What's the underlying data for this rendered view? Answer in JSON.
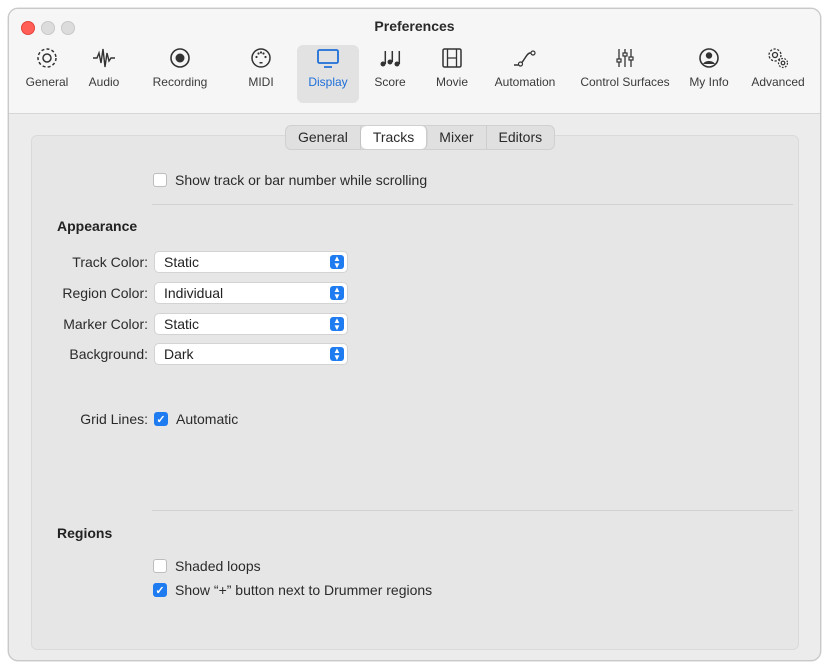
{
  "window": {
    "title": "Preferences"
  },
  "toolbar": {
    "items": [
      {
        "label": "General",
        "icon": "gear-icon"
      },
      {
        "label": "Audio",
        "icon": "waveform-icon"
      },
      {
        "label": "Recording",
        "icon": "record-icon"
      },
      {
        "label": "MIDI",
        "icon": "midi-port-icon"
      },
      {
        "label": "Display",
        "icon": "display-icon",
        "active": true
      },
      {
        "label": "Score",
        "icon": "music-notes-icon"
      },
      {
        "label": "Movie",
        "icon": "film-icon"
      },
      {
        "label": "Automation",
        "icon": "automation-curve-icon"
      },
      {
        "label": "Control Surfaces",
        "icon": "faders-icon"
      },
      {
        "label": "My Info",
        "icon": "person-icon"
      },
      {
        "label": "Advanced",
        "icon": "gears-icon"
      }
    ]
  },
  "tabs": [
    "General",
    "Tracks",
    "Mixer",
    "Editors"
  ],
  "active_tab": "Tracks",
  "show_track_number": {
    "label": "Show track or bar number while scrolling",
    "checked": false
  },
  "appearance": {
    "heading": "Appearance",
    "track_color": {
      "label": "Track Color:",
      "value": "Static"
    },
    "region_color": {
      "label": "Region Color:",
      "value": "Individual"
    },
    "marker_color": {
      "label": "Marker Color:",
      "value": "Static"
    },
    "background": {
      "label": "Background:",
      "value": "Dark"
    },
    "grid_lines": {
      "label": "Grid Lines:",
      "option": "Automatic",
      "checked": true
    }
  },
  "regions": {
    "heading": "Regions",
    "shaded_loops": {
      "label": "Shaded loops",
      "checked": false
    },
    "drummer_plus": {
      "label": "Show “+” button next to Drummer regions",
      "checked": true
    }
  },
  "colors": {
    "accent": "#1e7bf0",
    "close": "#ff5f57"
  }
}
